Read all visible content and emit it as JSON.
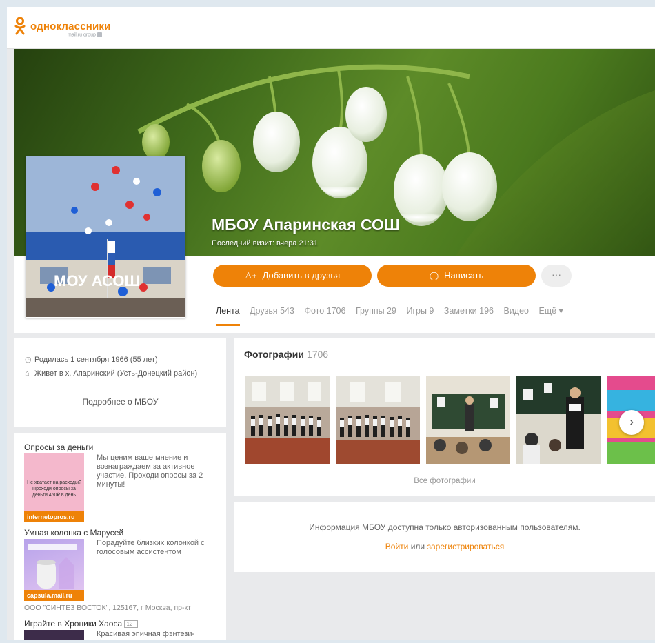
{
  "header": {
    "logo_text": "одноклассники",
    "logo_sub": "mail.ru group"
  },
  "profile": {
    "name": "МБОУ Апаринская СОШ",
    "last_visit": "Последний визит: вчера 21:31",
    "avatar_sign": "МОУ АСОШ",
    "add_friend_label": "Добавить в друзья",
    "message_label": "Написать",
    "more_label": "···",
    "tabs": [
      {
        "label": "Лента",
        "active": true
      },
      {
        "label": "Друзья 543"
      },
      {
        "label": "Фото 1706"
      },
      {
        "label": "Группы 29"
      },
      {
        "label": "Игры 9"
      },
      {
        "label": "Заметки 196"
      },
      {
        "label": "Видео"
      },
      {
        "label": "Ещё ▾"
      }
    ]
  },
  "info": {
    "born": "Родилась 1 сентября 1966 (55 лет)",
    "lives": "Живет в х. Апаринский (Усть-Донецкий район)",
    "more_link": "Подробнее о МБОУ"
  },
  "ads": [
    {
      "title": "Опросы за деньги",
      "text": "Мы ценим ваше мнение и вознаграждаем за активное участие. Проходи опросы за 2 минуты!",
      "thumb_text": "Не хватает на расходы? Проходи опросы за деньги 450₽ в день",
      "domain": "internetopros.ru"
    },
    {
      "title": "Умная колонка с Марусей",
      "text": "Порадуйте близких колонкой с голосовым ассистентом",
      "thumb_text": "",
      "domain": "capsula.mail.ru",
      "note": "ООО \"СИНТЕЗ ВОСТОК\", 125167, г Москва, пр-кт"
    },
    {
      "title": "Играйте в Хроники Хаоса",
      "age": "12+",
      "text": "Красивая эпичная фэнтези-битва"
    }
  ],
  "photos": {
    "title": "Фотографии",
    "count": "1706",
    "all_label": "Все фотографии",
    "next_label": "›"
  },
  "auth": {
    "text": "Информация МБОУ доступна только авторизованным пользователям.",
    "login": "Войти",
    "or": "или",
    "register": "зарегистрироваться"
  },
  "colors": {
    "accent": "#ee8208",
    "background": "#e9eaec"
  }
}
